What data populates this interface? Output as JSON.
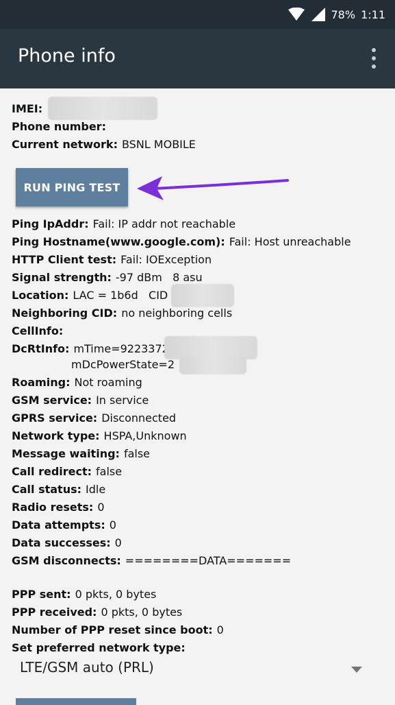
{
  "status_bar": {
    "battery": "78%",
    "time": "1:11"
  },
  "app_bar": {
    "title": "Phone info"
  },
  "info_top": [
    {
      "label": "IMEI:",
      "value": ""
    },
    {
      "label": "Phone number:",
      "value": ""
    },
    {
      "label": "Current network:",
      "value": "BSNL MOBILE"
    }
  ],
  "ping_button_label": "RUN PING TEST",
  "info": {
    "ping_ipaddr": {
      "label": "Ping IpAddr:",
      "value": "Fail: IP addr not reachable"
    },
    "ping_hostname": {
      "label": "Ping Hostname(www.google.com):",
      "value": "Fail: Host unreachable"
    },
    "http_client": {
      "label": "HTTP Client test:",
      "value": "Fail: IOException"
    },
    "signal": {
      "label": "Signal strength:",
      "value": "-97 dBm   8 asu"
    },
    "location": {
      "label": "Location:",
      "value": "LAC = 1b6d   CID"
    },
    "neighboring": {
      "label": "Neighboring CID:",
      "value": "no neighboring cells"
    },
    "cellinfo": {
      "label": "CellInfo:",
      "value": ""
    },
    "dcrtinfo": {
      "label": "DcRtInfo:",
      "value": "mTime=922337203",
      "value2": "mDcPowerState=2"
    },
    "roaming": {
      "label": "Roaming:",
      "value": "Not roaming"
    },
    "gsm_service": {
      "label": "GSM service:",
      "value": "In service"
    },
    "gprs_service": {
      "label": "GPRS service:",
      "value": "Disconnected"
    },
    "network_type": {
      "label": "Network type:",
      "value": "HSPA,Unknown"
    },
    "message_waiting": {
      "label": "Message waiting:",
      "value": "false"
    },
    "call_redirect": {
      "label": "Call redirect:",
      "value": "false"
    },
    "call_status": {
      "label": "Call status:",
      "value": "Idle"
    },
    "radio_resets": {
      "label": "Radio resets:",
      "value": "0"
    },
    "data_attempts": {
      "label": "Data attempts:",
      "value": "0"
    },
    "data_successes": {
      "label": "Data successes:",
      "value": "0"
    },
    "gsm_disconnects": {
      "label": "GSM disconnects:",
      "value": "========DATA======="
    },
    "ppp_sent": {
      "label": "PPP sent:",
      "value": "0 pkts, 0 bytes"
    },
    "ppp_received": {
      "label": "PPP received:",
      "value": "0 pkts, 0 bytes"
    },
    "ppp_reset": {
      "label": "Number of PPP reset since boot:",
      "value": "0"
    },
    "preferred_network": {
      "label": "Set preferred network type:",
      "value": ""
    }
  },
  "network_spinner": {
    "selected": "LTE/GSM auto (PRL)"
  },
  "colors": {
    "status_bar": "#222d36",
    "app_bar": "#2a3640",
    "button": "#5f7f9e",
    "arrow": "#7b2fd6"
  }
}
